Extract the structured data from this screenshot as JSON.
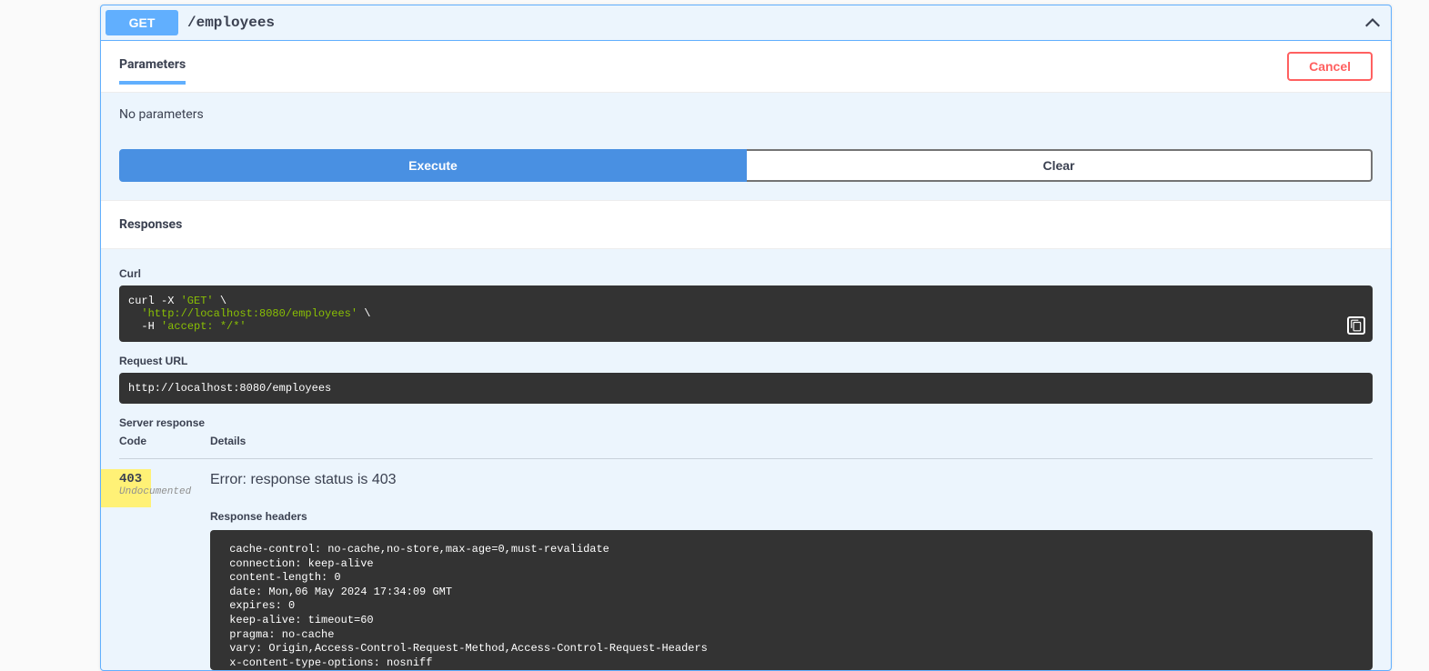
{
  "summary": {
    "method": "GET",
    "path": "/employees"
  },
  "tabs": {
    "parameters_label": "Parameters",
    "cancel_label": "Cancel"
  },
  "params": {
    "none_text": "No parameters"
  },
  "buttons": {
    "execute": "Execute",
    "clear": "Clear"
  },
  "responses": {
    "heading": "Responses",
    "curl_label": "Curl",
    "curl_l1a": "curl -X ",
    "curl_l1b": "'GET'",
    "curl_l1c": " \\",
    "curl_l2a": "  ",
    "curl_l2b": "'http://localhost:8080/employees'",
    "curl_l2c": " \\",
    "curl_l3a": "  -H ",
    "curl_l3b": "'accept: */*'",
    "request_url_label": "Request URL",
    "request_url": "http://localhost:8080/employees",
    "server_response_label": "Server response",
    "col_code": "Code",
    "col_details": "Details",
    "status_code": "403",
    "undocumented": "Undocumented",
    "error_text": "Error: response status is 403",
    "response_headers_label": "Response headers",
    "headers_body": " cache-control: no-cache,no-store,max-age=0,must-revalidate \n connection: keep-alive \n content-length: 0 \n date: Mon,06 May 2024 17:34:09 GMT \n expires: 0 \n keep-alive: timeout=60 \n pragma: no-cache \n vary: Origin,Access-Control-Request-Method,Access-Control-Request-Headers \n x-content-type-options: nosniff "
  }
}
